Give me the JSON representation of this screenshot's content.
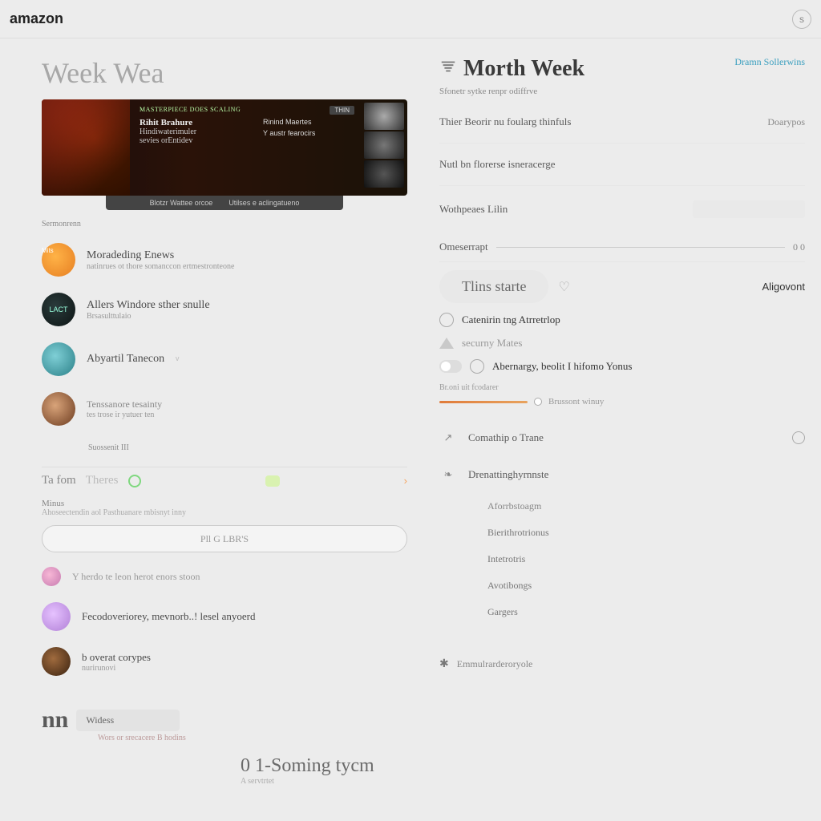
{
  "topbar": {
    "logo": "amazon",
    "icon_label": "s"
  },
  "left": {
    "title": "Week Wea",
    "hero": {
      "category": "Masterpiece Does Scaling",
      "line1": "Rihit Brahure",
      "line2": "Hindiwaterimuler",
      "line3": "sevies orEntidev",
      "r_badge": "THIN",
      "r_line1": "Rinind Maertes",
      "r_line2": "Y austr fearocirs",
      "footer1": "Blotzr Wattee orcoe",
      "footer2": "Utilses e aclingatueno"
    },
    "section1_label": "Sermonrenn",
    "items": [
      {
        "title": "Moradeding Enews",
        "sub": "natinrues ot thore somanccon ertmestronteone"
      },
      {
        "title": "Allers Windore sther snulle",
        "sub": "Brsasulttulaio",
        "badge": "LACT"
      },
      {
        "title": "Abyartil Tanecon",
        "sub": "",
        "verified": true
      },
      {
        "title": "Tenssanore tesainty",
        "sub": "tes trose ir yutuer ten"
      }
    ],
    "extra_line": "Suossenit III",
    "tabs": {
      "a": "Ta fom",
      "b": "Theres"
    },
    "muted": {
      "head": "Minus",
      "desc": "Ahoseectendin aol Pasthuanare mbisnyt inny"
    },
    "search_placeholder": "Pll G LBR'S",
    "bottom_items": [
      {
        "text": "Y herdo te leon herot enors stoon"
      },
      {
        "text": "Fecodoveriorey, mevnorb..! lesel anyoerd"
      },
      {
        "text": "b overat corypes",
        "sub": "nurirunovi"
      }
    ],
    "mn": {
      "logo": "nn",
      "chip": "Widess",
      "sub": "Wors or srecacere B hodins"
    }
  },
  "right": {
    "title": "Morth Week",
    "link": "Dramn Sollerwins",
    "subline": "Sfonetr sytke renpr odiffrve",
    "rows": [
      {
        "label": "Thier Beorir nu foularg thinfuls",
        "value": "Doarypos"
      },
      {
        "label": "Nutl bn florerse isneracerge",
        "value": ""
      }
    ],
    "input_row": {
      "label": "Wothpeaes Lilin"
    },
    "slider": {
      "label": "Omeserrapt",
      "value": "0 0"
    },
    "pill": "Tlins starte",
    "align_label": "Aligovont",
    "checks": [
      {
        "text": "Catenirin tng Atrretrlop"
      },
      {
        "text": "securny Mates"
      },
      {
        "text": "Abernargy, beolit I hifomo Yonus"
      }
    ],
    "progress": {
      "label": "Br.oni uit fcodarer",
      "tag": "Brussont winuy"
    },
    "options": [
      {
        "text": "Comathip o Trane",
        "ring": true
      },
      {
        "text": "Drenattinghyrnnste"
      }
    ],
    "sublist": [
      "Aforrbstoagm",
      "Bierithrotrionus",
      "Intetrotris",
      "Avotibongs",
      "Gargers"
    ],
    "bottom": "Emmulrarderoryole"
  },
  "right2": {
    "big": "0 1-Soming tycm",
    "sub": "A servtrtet"
  }
}
